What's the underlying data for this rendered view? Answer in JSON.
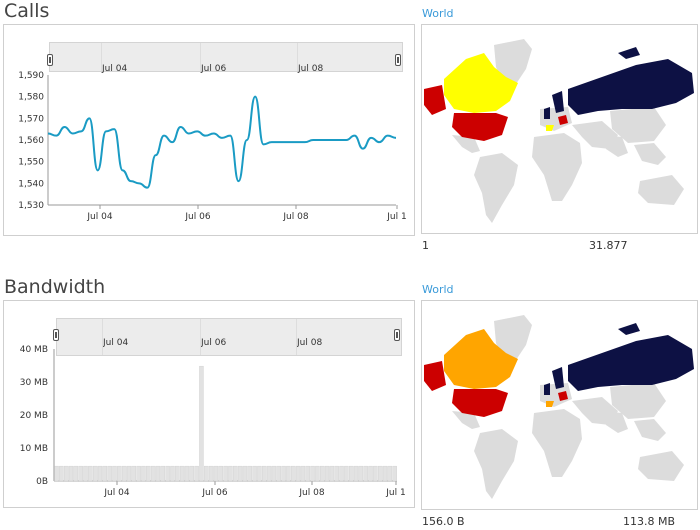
{
  "calls": {
    "title": "Calls",
    "navigator_labels": [
      "Jul 04",
      "Jul 06",
      "Jul 08"
    ],
    "chart_data": {
      "type": "line",
      "x_ticks": [
        "Jul 04",
        "Jul 06",
        "Jul 08",
        "Jul 1"
      ],
      "y_ticks": [
        "1,590",
        "1,580",
        "1,570",
        "1,560",
        "1,550",
        "1,540",
        "1,530"
      ],
      "ylim": [
        1530,
        1590
      ],
      "series_color": "#1a9bc4",
      "x": [
        0,
        1,
        2,
        3,
        4,
        5,
        6,
        7,
        8,
        9,
        10,
        11,
        12,
        13,
        14,
        15,
        16,
        17,
        18,
        19,
        20,
        21,
        22,
        23,
        24,
        25,
        26,
        27,
        28,
        29,
        30,
        31,
        32,
        33,
        34,
        35,
        36,
        37,
        38,
        39,
        40,
        41,
        42
      ],
      "values": [
        1563,
        1562,
        1566,
        1563,
        1564,
        1570,
        1546,
        1564,
        1565,
        1546,
        1541,
        1540,
        1538,
        1553,
        1562,
        1559,
        1566,
        1563,
        1564,
        1562,
        1563,
        1561,
        1562,
        1541,
        1560,
        1580,
        1558,
        1559,
        1559,
        1559,
        1559,
        1559,
        1560,
        1560,
        1560,
        1560,
        1560,
        1562,
        1556,
        1561,
        1559,
        1562,
        1561
      ]
    },
    "map": {
      "link": "World",
      "legend_min": "1",
      "legend_max": "31.877",
      "colors": {
        "high": "#0d1144",
        "mid": "#cc0000",
        "low": "#ffff00",
        "none": "#dcdcdc"
      }
    }
  },
  "bandwidth": {
    "title": "Bandwidth",
    "navigator_labels": [
      "Jul 04",
      "Jul 06",
      "Jul 08"
    ],
    "chart_data": {
      "type": "bar",
      "x_ticks": [
        "Jul 04",
        "Jul 06",
        "Jul 08",
        "Jul 1"
      ],
      "y_ticks": [
        "40 MB",
        "30 MB",
        "20 MB",
        "10 MB",
        "0B"
      ],
      "ylim": [
        0,
        40
      ],
      "bar_color": "#e2e2e2",
      "values": [
        4.5,
        4.5,
        4.5,
        4.5,
        4.5,
        4.5,
        4.5,
        4.5,
        4.5,
        4.5,
        4.5,
        4.5,
        4.5,
        4.5,
        4.5,
        4.5,
        4.5,
        4.5,
        4.5,
        4.5,
        4.5,
        4.5,
        4.5,
        4.5,
        4.5,
        4.5,
        4.5,
        4.5,
        4.5,
        4.5,
        34.8,
        4.5,
        4.5,
        4.5,
        4.5,
        4.5,
        4.5,
        4.5,
        4.5,
        4.5,
        4.5,
        4.5,
        4.5,
        4.5,
        4.5,
        4.5,
        4.5,
        4.5,
        4.5,
        4.5,
        4.5,
        4.5,
        4.5,
        4.5,
        4.5,
        4.5,
        4.5,
        4.5,
        4.5,
        4.5,
        4.5,
        4.5,
        4.5,
        4.5,
        4.5,
        4.5,
        4.5,
        4.5,
        4.5,
        4.5,
        4.5
      ]
    },
    "map": {
      "link": "World",
      "legend_min": "156.0 B",
      "legend_max": "113.8 MB",
      "colors": {
        "high": "#0d1144",
        "mid": "#cc0000",
        "low": "#ffa500",
        "none": "#dcdcdc"
      }
    }
  }
}
